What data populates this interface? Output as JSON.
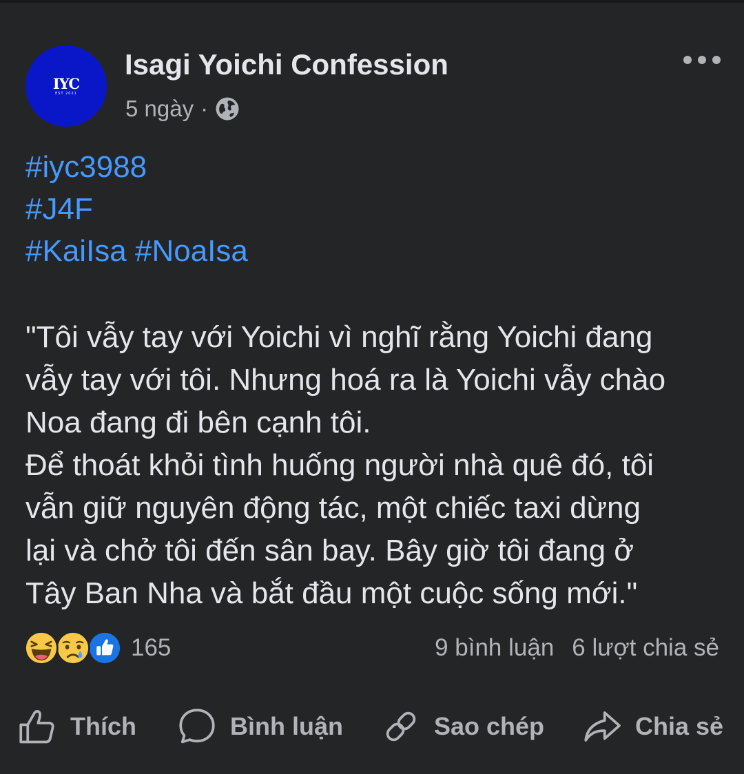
{
  "post": {
    "page_name": "Isagi Yoichi Confession",
    "avatar_text": "IYC",
    "avatar_subtext": "EST 2021",
    "time": "5 ngày",
    "separator": "·",
    "privacy_icon": "globe-icon",
    "hashtags": [
      "#iyc3988",
      "#J4F",
      "#KaiIsa #NoaIsa"
    ],
    "body_lines": [
      "\"Tôi vẫy tay với Yoichi vì nghĩ rằng Yoichi đang",
      "vẫy tay với tôi. Nhưng hoá ra là Yoichi vẫy chào",
      "Noa đang đi bên cạnh tôi.",
      "Để thoát khỏi tình huống người nhà quê đó, tôi",
      "vẫn giữ nguyên động tác, một chiếc taxi dừng",
      "lại và chở tôi đến sân bay. Bây giờ tôi đang ở",
      "Tây Ban Nha và bắt đầu một cuộc sống mới.\""
    ]
  },
  "reactions": {
    "icons": [
      "haha-icon",
      "sad-icon",
      "like-icon"
    ],
    "count": "165",
    "comments": "9 bình luận",
    "shares": "6 lượt chia sẻ"
  },
  "actions": {
    "like": "Thích",
    "comment": "Bình luận",
    "copy": "Sao chép",
    "share": "Chia sẻ"
  },
  "colors": {
    "background": "#242526",
    "hashtag": "#4599ff",
    "text": "#e4e6eb",
    "secondary": "#b0b3b8",
    "avatar": "#0a17c9"
  }
}
